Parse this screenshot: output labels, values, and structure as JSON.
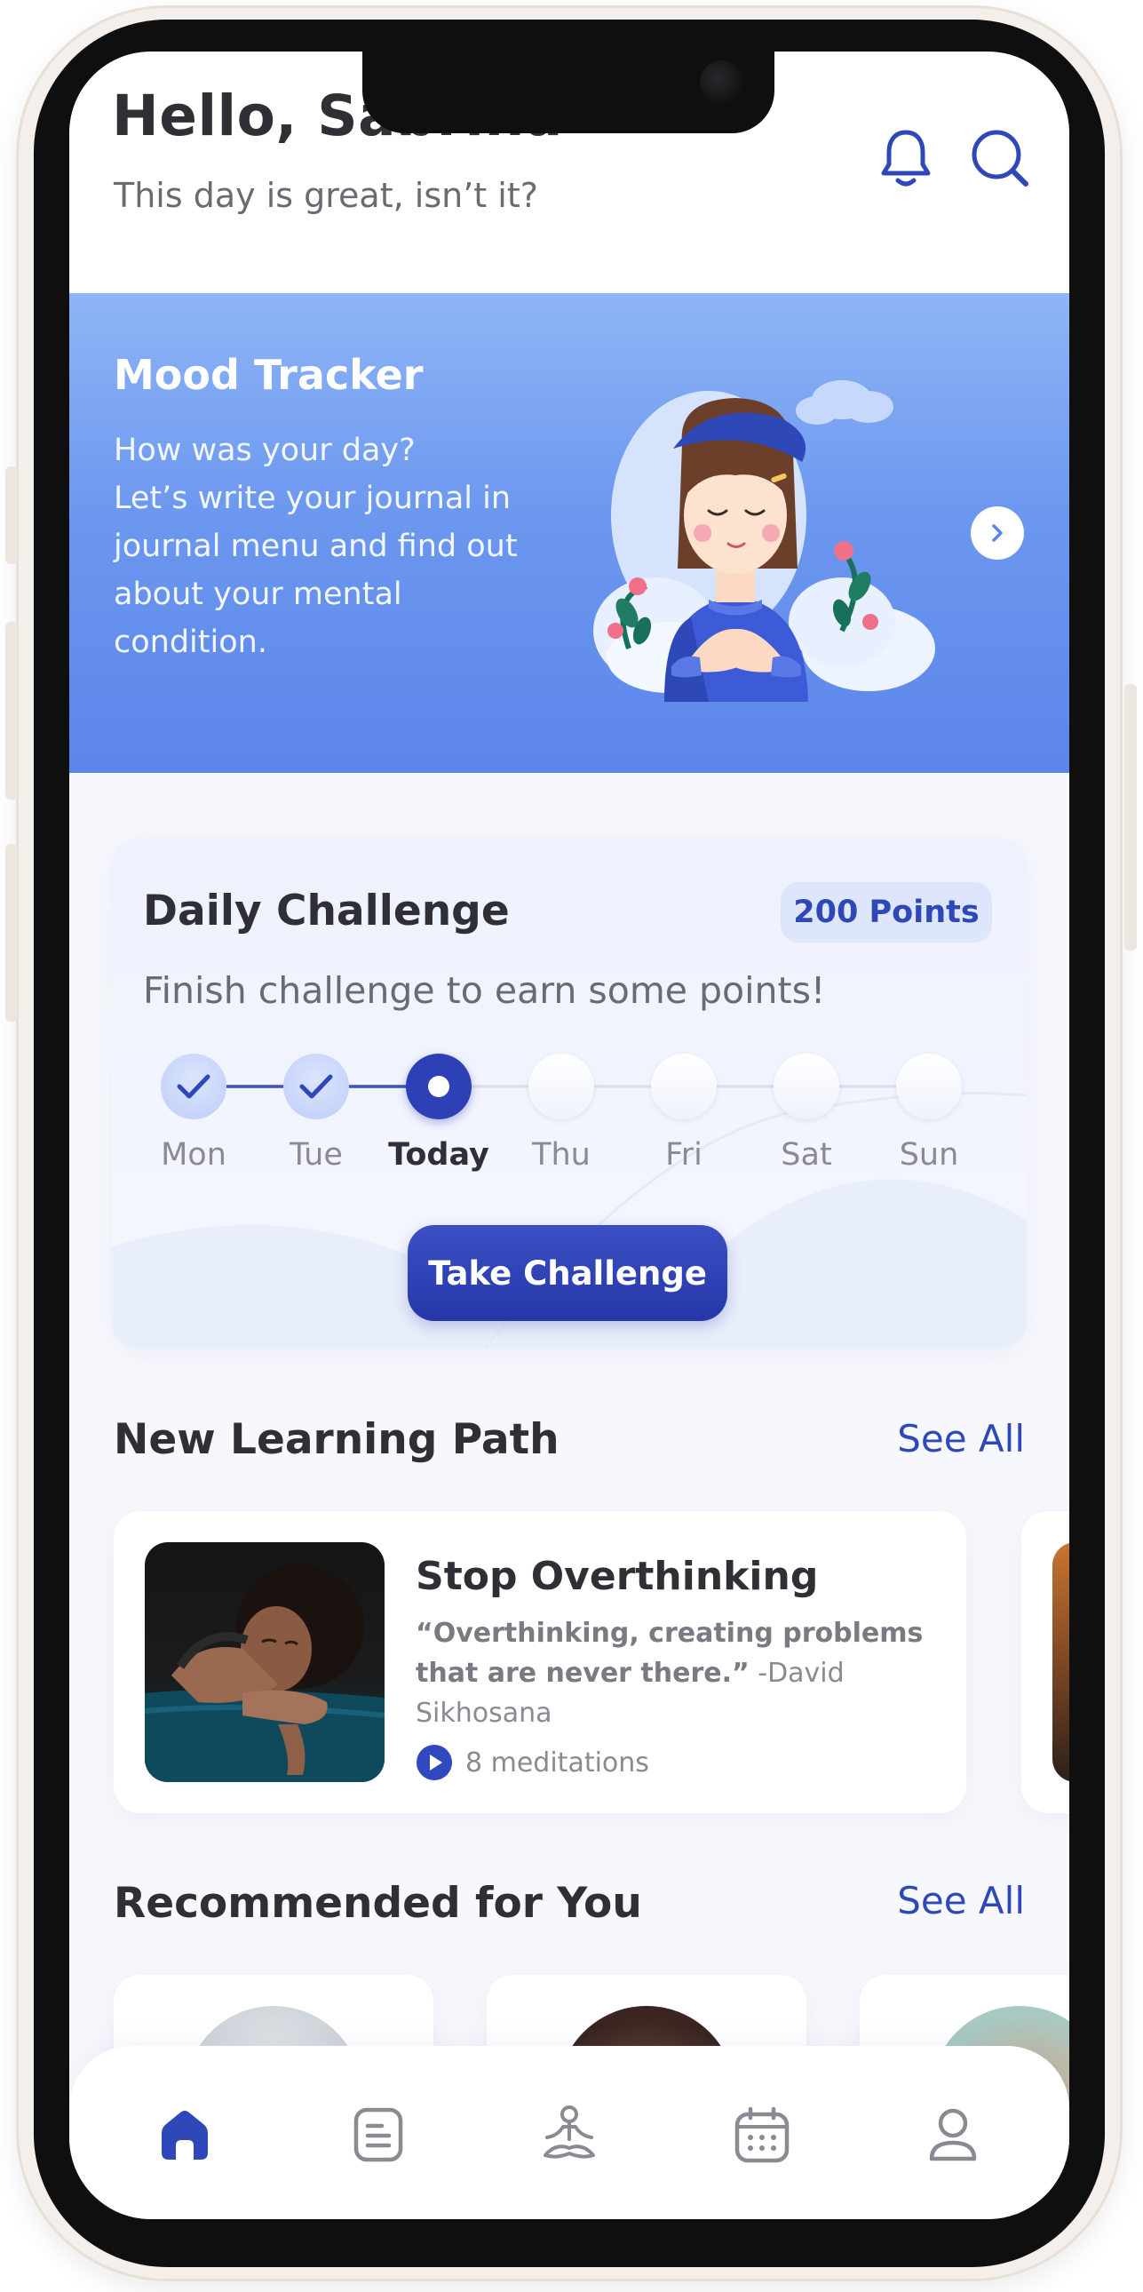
{
  "header": {
    "greeting": "Hello, Sabrina",
    "subtitle": "This day is great, isn’t it?"
  },
  "mood_tracker": {
    "title": "Mood Tracker",
    "lines": [
      "How was your day?",
      "Let’s write your journal in",
      "journal menu and find out",
      "about your mental",
      "condition."
    ]
  },
  "daily_challenge": {
    "title": "Daily Challenge",
    "points": "200 Points",
    "subtitle": "Finish challenge to earn some points!",
    "days": [
      {
        "label": "Mon",
        "state": "done"
      },
      {
        "label": "Tue",
        "state": "done"
      },
      {
        "label": "Today",
        "state": "current"
      },
      {
        "label": "Thu",
        "state": "upcoming"
      },
      {
        "label": "Fri",
        "state": "upcoming"
      },
      {
        "label": "Sat",
        "state": "upcoming"
      },
      {
        "label": "Sun",
        "state": "upcoming"
      }
    ],
    "button": "Take Challenge"
  },
  "learning_path": {
    "title": "New Learning Path",
    "see_all": "See All",
    "card": {
      "title": "Stop Overthinking",
      "quote_bold": "“Overthinking, creating problems that are never there.”",
      "quote_author": " -David Sikhosana",
      "meta": "8 meditations"
    }
  },
  "recommended": {
    "title": "Recommended for You",
    "see_all": "See All"
  },
  "tabbar": {
    "items": [
      "home-icon",
      "journal-icon",
      "meditation-icon",
      "calendar-icon",
      "profile-icon"
    ],
    "active": "home-icon"
  },
  "colors": {
    "accent": "#2e48b8",
    "mood_gradient_top": "#8fb5f6",
    "mood_gradient_bottom": "#5b86ea",
    "text_dark": "#2f2f35",
    "text_muted": "#6a6a72"
  }
}
